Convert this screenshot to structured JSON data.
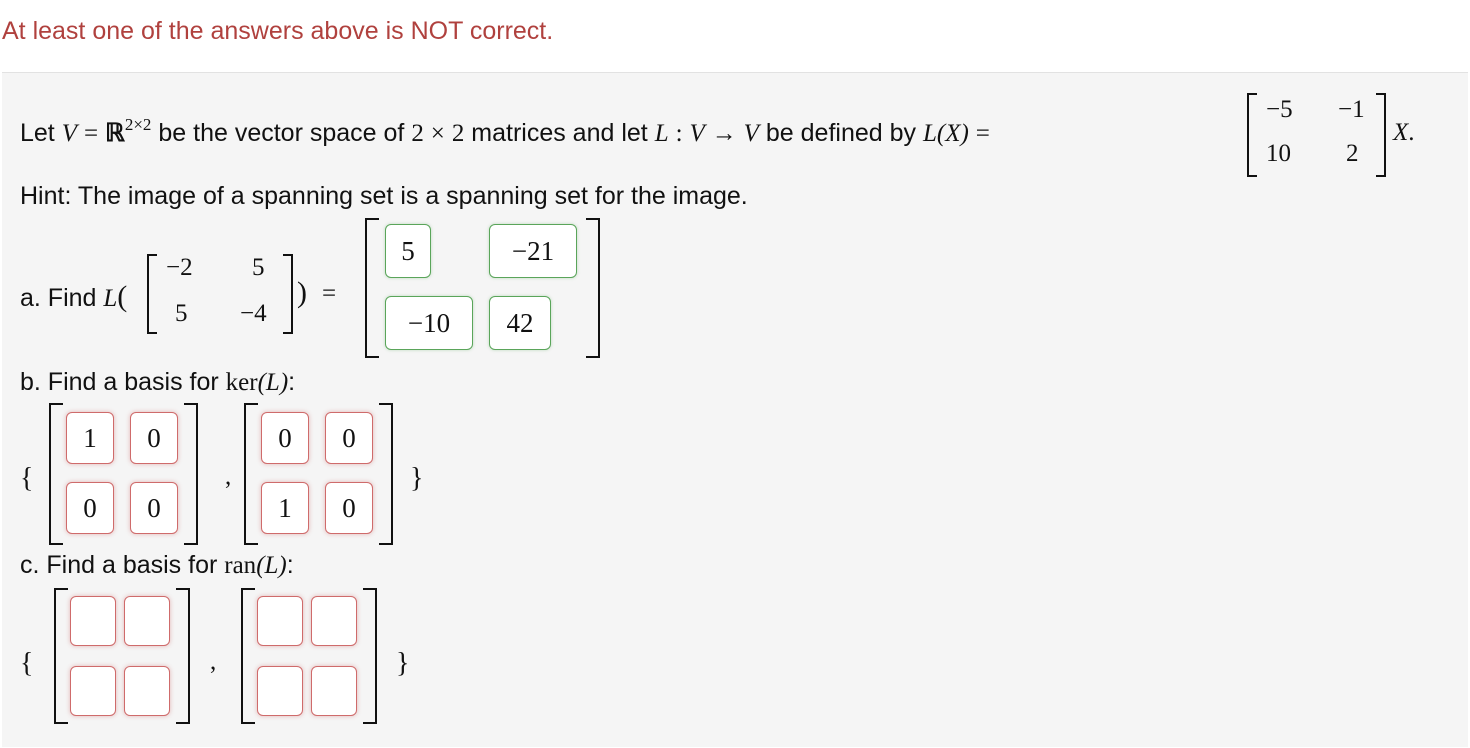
{
  "warning": "At least one of the answers above is NOT correct.",
  "intro": {
    "let": "Let",
    "V": "V",
    "eq": "=",
    "R": "ℝ",
    "dims": "2×2",
    "t1": "be the vector space of",
    "two": "2",
    "times": "×",
    "t2": "matrices and let",
    "L": "L",
    "colon": ":",
    "arrow": "→",
    "t3": "be defined by",
    "LX": "L(X)",
    "X": "X",
    "period": ".",
    "matrix": [
      "−5",
      "−1",
      "10",
      "2"
    ]
  },
  "hint": "Hint: The image of a spanning set is a spanning set for the image.",
  "part_a": {
    "label": "a. Find",
    "L": "L",
    "open": "(",
    "close": ")",
    "eq": "=",
    "matrix": [
      "−2",
      "5",
      "5",
      "−4"
    ],
    "answers": [
      "5",
      "−21",
      "−10",
      "42"
    ]
  },
  "part_b": {
    "label": "b. Find a basis for",
    "func": "ker",
    "arg": "(L)",
    "colon": ":",
    "basis": [
      [
        "1",
        "0",
        "0",
        "0"
      ],
      [
        "0",
        "0",
        "1",
        "0"
      ]
    ],
    "open_brace": "{",
    "close_brace": "}",
    "comma": ","
  },
  "part_c": {
    "label": "c. Find a basis for",
    "func": "ran",
    "arg": "(L)",
    "colon": ":",
    "basis": [
      [
        "",
        "",
        "",
        ""
      ],
      [
        "",
        "",
        "",
        ""
      ]
    ],
    "open_brace": "{",
    "close_brace": "}",
    "comma": ","
  }
}
